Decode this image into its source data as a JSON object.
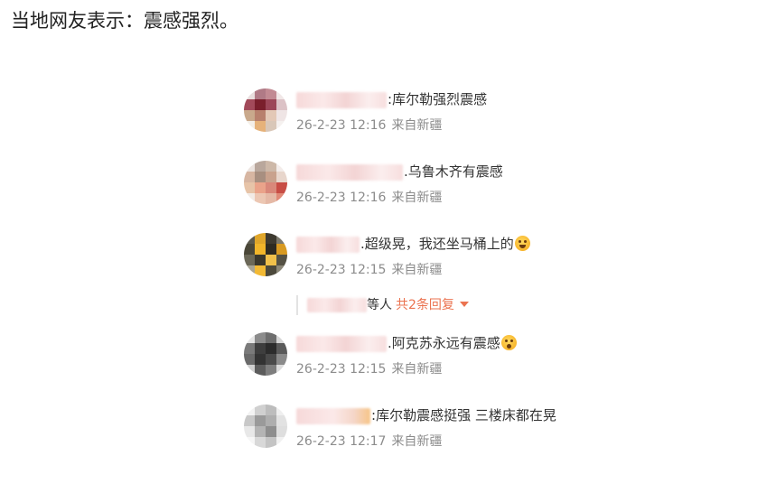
{
  "heading": "当地网友表示：震感强烈。",
  "comments": [
    {
      "separator": ":",
      "text": "库尔勒强烈震感",
      "time": "26-2-23 12:16",
      "location": "来自新疆"
    },
    {
      "separator": ".",
      "text": "乌鲁木齐有震感",
      "time": "26-2-23 12:16",
      "location": "来自新疆"
    },
    {
      "separator": ".",
      "text": "超级晃，我还坐马桶上的",
      "emoji": "laughing-tears-emoji",
      "time": "26-2-23 12:15",
      "location": "来自新疆",
      "replies": {
        "suffix": "等人",
        "more": "共2条回复",
        "icon": "caret-down-icon"
      }
    },
    {
      "separator": ".",
      "text": "阿克苏永远有震感",
      "emoji": "shocked-face-emoji",
      "time": "26-2-23 12:15",
      "location": "来自新疆"
    },
    {
      "separator": ":",
      "text": "库尔勒震感挺强 三楼床都在晃",
      "time": "26-2-23 12:17",
      "location": "来自新疆"
    }
  ],
  "colors": {
    "text": "#333333",
    "meta": "#8c8c8c",
    "link": "#eb7350",
    "name_blur": "#f6d9d9"
  }
}
